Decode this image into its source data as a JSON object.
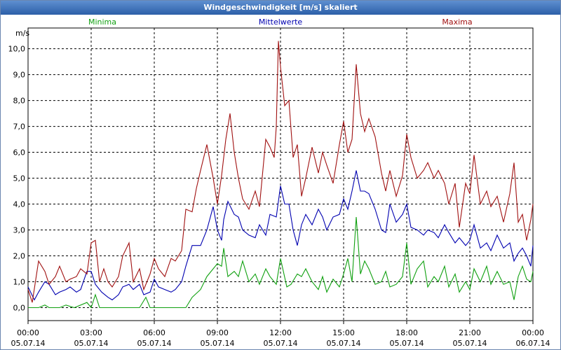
{
  "window": {
    "title": "Windgeschwindigkeit [m/s] skaliert"
  },
  "chart_data": {
    "type": "line",
    "title": "Windgeschwindigkeit [m/s] skaliert",
    "ylabel": "m/s",
    "ylim": [
      -0.5,
      10.8
    ],
    "grid": true,
    "legend_position": "top",
    "y_ticks": [
      "0,0",
      "1,0",
      "2,0",
      "3,0",
      "4,0",
      "5,0",
      "6,0",
      "7,0",
      "8,0",
      "9,0",
      "10,0"
    ],
    "y_tick_values": [
      0,
      1,
      2,
      3,
      4,
      5,
      6,
      7,
      8,
      9,
      10
    ],
    "x_ticks": [
      {
        "time": "00:00",
        "date": "05.07.14"
      },
      {
        "time": "03:00",
        "date": "05.07.14"
      },
      {
        "time": "06:00",
        "date": "05.07.14"
      },
      {
        "time": "09:00",
        "date": "05.07.14"
      },
      {
        "time": "12:00",
        "date": "05.07.14"
      },
      {
        "time": "15:00",
        "date": "05.07.14"
      },
      {
        "time": "18:00",
        "date": "05.07.14"
      },
      {
        "time": "21:00",
        "date": "05.07.14"
      },
      {
        "time": "00:00",
        "date": "06.07.14"
      }
    ],
    "x_tick_hours": [
      0,
      3,
      6,
      9,
      12,
      15,
      18,
      21,
      24
    ],
    "x_range_hours": [
      0,
      24
    ],
    "series": [
      {
        "name": "Minima",
        "color": "#10a010",
        "points": [
          [
            0,
            0
          ],
          [
            0.5,
            0
          ],
          [
            0.8,
            0.1
          ],
          [
            1.0,
            0
          ],
          [
            1.5,
            0
          ],
          [
            1.8,
            0.1
          ],
          [
            2.2,
            0
          ],
          [
            2.8,
            0.2
          ],
          [
            3.0,
            0
          ],
          [
            3.2,
            0.5
          ],
          [
            3.4,
            0
          ],
          [
            4.0,
            0
          ],
          [
            4.5,
            0
          ],
          [
            5.0,
            0
          ],
          [
            5.3,
            0
          ],
          [
            5.6,
            0.4
          ],
          [
            5.8,
            0
          ],
          [
            6.2,
            0
          ],
          [
            6.5,
            0
          ],
          [
            7.0,
            0
          ],
          [
            7.5,
            0
          ],
          [
            7.8,
            0.4
          ],
          [
            8.2,
            0.7
          ],
          [
            8.5,
            1.2
          ],
          [
            8.8,
            1.5
          ],
          [
            9.0,
            1.7
          ],
          [
            9.2,
            1.6
          ],
          [
            9.3,
            2.3
          ],
          [
            9.5,
            1.2
          ],
          [
            9.8,
            1.4
          ],
          [
            10.0,
            1.2
          ],
          [
            10.2,
            1.8
          ],
          [
            10.5,
            1.0
          ],
          [
            10.8,
            1.3
          ],
          [
            11.0,
            0.9
          ],
          [
            11.3,
            1.5
          ],
          [
            11.5,
            1.2
          ],
          [
            11.8,
            0.9
          ],
          [
            12.0,
            1.9
          ],
          [
            12.3,
            0.8
          ],
          [
            12.5,
            0.9
          ],
          [
            12.8,
            1.3
          ],
          [
            13.0,
            1.2
          ],
          [
            13.2,
            1.5
          ],
          [
            13.5,
            1.0
          ],
          [
            13.8,
            0.7
          ],
          [
            14.0,
            1.2
          ],
          [
            14.2,
            0.6
          ],
          [
            14.5,
            1.1
          ],
          [
            14.8,
            0.8
          ],
          [
            15.0,
            1.3
          ],
          [
            15.2,
            1.9
          ],
          [
            15.4,
            1.0
          ],
          [
            15.6,
            3.5
          ],
          [
            15.8,
            1.3
          ],
          [
            16.0,
            1.8
          ],
          [
            16.2,
            1.5
          ],
          [
            16.5,
            0.9
          ],
          [
            16.8,
            1.0
          ],
          [
            17.0,
            1.4
          ],
          [
            17.2,
            0.8
          ],
          [
            17.5,
            0.9
          ],
          [
            17.8,
            1.2
          ],
          [
            18.0,
            2.5
          ],
          [
            18.2,
            0.9
          ],
          [
            18.5,
            1.5
          ],
          [
            18.8,
            1.8
          ],
          [
            19.0,
            0.8
          ],
          [
            19.3,
            1.2
          ],
          [
            19.5,
            1.0
          ],
          [
            19.8,
            1.6
          ],
          [
            20.0,
            0.8
          ],
          [
            20.3,
            1.3
          ],
          [
            20.5,
            0.6
          ],
          [
            20.8,
            1.0
          ],
          [
            21.0,
            0.7
          ],
          [
            21.2,
            1.5
          ],
          [
            21.5,
            1.0
          ],
          [
            21.8,
            1.6
          ],
          [
            22.0,
            0.9
          ],
          [
            22.3,
            1.4
          ],
          [
            22.6,
            0.9
          ],
          [
            22.9,
            1.0
          ],
          [
            23.1,
            0.3
          ],
          [
            23.3,
            1.2
          ],
          [
            23.5,
            1.6
          ],
          [
            23.7,
            1.1
          ],
          [
            23.9,
            1.0
          ],
          [
            24.0,
            1.4
          ]
        ]
      },
      {
        "name": "Mittelwerte",
        "color": "#0000b0",
        "points": [
          [
            0,
            0.8
          ],
          [
            0.3,
            0.3
          ],
          [
            0.5,
            0.6
          ],
          [
            0.8,
            1.0
          ],
          [
            1.0,
            0.9
          ],
          [
            1.3,
            0.5
          ],
          [
            1.5,
            0.6
          ],
          [
            1.8,
            0.7
          ],
          [
            2.0,
            0.8
          ],
          [
            2.3,
            0.6
          ],
          [
            2.5,
            0.7
          ],
          [
            2.8,
            1.4
          ],
          [
            3.0,
            1.4
          ],
          [
            3.2,
            0.9
          ],
          [
            3.5,
            0.6
          ],
          [
            3.8,
            0.4
          ],
          [
            4.0,
            0.3
          ],
          [
            4.3,
            0.5
          ],
          [
            4.5,
            0.8
          ],
          [
            4.8,
            0.9
          ],
          [
            5.0,
            0.7
          ],
          [
            5.3,
            0.9
          ],
          [
            5.5,
            0.5
          ],
          [
            5.8,
            0.6
          ],
          [
            6.0,
            1.1
          ],
          [
            6.2,
            0.8
          ],
          [
            6.5,
            0.7
          ],
          [
            6.8,
            0.6
          ],
          [
            7.0,
            0.7
          ],
          [
            7.3,
            1.0
          ],
          [
            7.5,
            1.6
          ],
          [
            7.8,
            2.4
          ],
          [
            8.2,
            2.4
          ],
          [
            8.5,
            3.0
          ],
          [
            8.8,
            3.9
          ],
          [
            9.0,
            3.0
          ],
          [
            9.2,
            2.6
          ],
          [
            9.3,
            3.4
          ],
          [
            9.5,
            4.1
          ],
          [
            9.8,
            3.6
          ],
          [
            10.0,
            3.5
          ],
          [
            10.2,
            3.0
          ],
          [
            10.5,
            2.8
          ],
          [
            10.8,
            2.7
          ],
          [
            11.0,
            3.2
          ],
          [
            11.3,
            2.8
          ],
          [
            11.5,
            3.6
          ],
          [
            11.8,
            3.5
          ],
          [
            12.0,
            4.7
          ],
          [
            12.2,
            4.0
          ],
          [
            12.4,
            4.0
          ],
          [
            12.6,
            3.0
          ],
          [
            12.8,
            2.4
          ],
          [
            13.0,
            3.2
          ],
          [
            13.2,
            3.6
          ],
          [
            13.5,
            3.2
          ],
          [
            13.8,
            3.8
          ],
          [
            14.0,
            3.5
          ],
          [
            14.2,
            3.0
          ],
          [
            14.5,
            3.5
          ],
          [
            14.8,
            3.6
          ],
          [
            15.0,
            4.2
          ],
          [
            15.2,
            3.8
          ],
          [
            15.4,
            4.5
          ],
          [
            15.6,
            5.3
          ],
          [
            15.8,
            4.5
          ],
          [
            16.0,
            4.5
          ],
          [
            16.2,
            4.4
          ],
          [
            16.5,
            3.8
          ],
          [
            16.8,
            3.0
          ],
          [
            17.0,
            2.9
          ],
          [
            17.2,
            4.0
          ],
          [
            17.5,
            3.3
          ],
          [
            17.8,
            3.6
          ],
          [
            18.0,
            4.0
          ],
          [
            18.2,
            3.1
          ],
          [
            18.5,
            3.0
          ],
          [
            18.8,
            2.8
          ],
          [
            19.0,
            3.0
          ],
          [
            19.3,
            2.9
          ],
          [
            19.5,
            2.7
          ],
          [
            19.8,
            3.2
          ],
          [
            20.0,
            2.9
          ],
          [
            20.3,
            2.5
          ],
          [
            20.5,
            2.7
          ],
          [
            20.8,
            2.4
          ],
          [
            21.0,
            2.6
          ],
          [
            21.2,
            3.2
          ],
          [
            21.5,
            2.3
          ],
          [
            21.8,
            2.5
          ],
          [
            22.0,
            2.2
          ],
          [
            22.3,
            2.8
          ],
          [
            22.6,
            2.3
          ],
          [
            22.9,
            2.5
          ],
          [
            23.1,
            1.8
          ],
          [
            23.3,
            2.1
          ],
          [
            23.5,
            2.3
          ],
          [
            23.7,
            2.0
          ],
          [
            23.9,
            1.6
          ],
          [
            24.0,
            2.4
          ]
        ]
      },
      {
        "name": "Maxima",
        "color": "#a01010",
        "points": [
          [
            0,
            0.7
          ],
          [
            0.2,
            0.2
          ],
          [
            0.5,
            1.8
          ],
          [
            0.8,
            1.4
          ],
          [
            1.0,
            0.9
          ],
          [
            1.3,
            1.2
          ],
          [
            1.5,
            1.6
          ],
          [
            1.8,
            1.0
          ],
          [
            2.0,
            1.1
          ],
          [
            2.3,
            1.2
          ],
          [
            2.5,
            1.5
          ],
          [
            2.8,
            1.3
          ],
          [
            3.0,
            2.5
          ],
          [
            3.2,
            2.6
          ],
          [
            3.4,
            1.0
          ],
          [
            3.6,
            1.5
          ],
          [
            3.8,
            1.0
          ],
          [
            4.0,
            0.8
          ],
          [
            4.3,
            1.2
          ],
          [
            4.5,
            2.0
          ],
          [
            4.8,
            2.5
          ],
          [
            5.0,
            1.0
          ],
          [
            5.3,
            1.5
          ],
          [
            5.5,
            0.7
          ],
          [
            5.8,
            1.3
          ],
          [
            6.0,
            1.9
          ],
          [
            6.2,
            1.5
          ],
          [
            6.5,
            1.2
          ],
          [
            6.8,
            1.9
          ],
          [
            7.0,
            1.8
          ],
          [
            7.3,
            2.2
          ],
          [
            7.5,
            3.8
          ],
          [
            7.8,
            3.7
          ],
          [
            8.0,
            4.6
          ],
          [
            8.2,
            5.3
          ],
          [
            8.5,
            6.3
          ],
          [
            8.8,
            5.0
          ],
          [
            9.0,
            4.0
          ],
          [
            9.2,
            5.1
          ],
          [
            9.4,
            6.5
          ],
          [
            9.6,
            7.5
          ],
          [
            9.8,
            6.0
          ],
          [
            10.0,
            5.0
          ],
          [
            10.2,
            4.2
          ],
          [
            10.5,
            3.8
          ],
          [
            10.8,
            4.5
          ],
          [
            11.0,
            3.9
          ],
          [
            11.3,
            6.5
          ],
          [
            11.5,
            6.2
          ],
          [
            11.7,
            5.8
          ],
          [
            11.8,
            7.0
          ],
          [
            11.9,
            10.3
          ],
          [
            12.0,
            9.3
          ],
          [
            12.2,
            7.8
          ],
          [
            12.4,
            8.0
          ],
          [
            12.6,
            5.8
          ],
          [
            12.8,
            6.3
          ],
          [
            13.0,
            4.3
          ],
          [
            13.2,
            5.0
          ],
          [
            13.5,
            6.2
          ],
          [
            13.8,
            5.2
          ],
          [
            14.0,
            6.0
          ],
          [
            14.2,
            5.5
          ],
          [
            14.5,
            4.8
          ],
          [
            14.8,
            6.3
          ],
          [
            15.0,
            7.2
          ],
          [
            15.2,
            6.0
          ],
          [
            15.4,
            6.5
          ],
          [
            15.6,
            9.4
          ],
          [
            15.8,
            7.5
          ],
          [
            16.0,
            6.8
          ],
          [
            16.2,
            7.3
          ],
          [
            16.5,
            6.6
          ],
          [
            16.8,
            5.2
          ],
          [
            17.0,
            4.5
          ],
          [
            17.2,
            5.3
          ],
          [
            17.5,
            4.3
          ],
          [
            17.8,
            5.1
          ],
          [
            18.0,
            6.7
          ],
          [
            18.2,
            5.8
          ],
          [
            18.5,
            5.0
          ],
          [
            18.8,
            5.3
          ],
          [
            19.0,
            5.6
          ],
          [
            19.3,
            5.0
          ],
          [
            19.5,
            5.3
          ],
          [
            19.8,
            4.8
          ],
          [
            20.0,
            4.0
          ],
          [
            20.3,
            4.8
          ],
          [
            20.5,
            3.1
          ],
          [
            20.8,
            4.8
          ],
          [
            21.0,
            4.4
          ],
          [
            21.2,
            5.9
          ],
          [
            21.5,
            4.0
          ],
          [
            21.8,
            4.5
          ],
          [
            22.0,
            3.9
          ],
          [
            22.3,
            4.3
          ],
          [
            22.6,
            3.3
          ],
          [
            22.9,
            4.4
          ],
          [
            23.1,
            5.6
          ],
          [
            23.3,
            3.3
          ],
          [
            23.5,
            3.6
          ],
          [
            23.7,
            2.6
          ],
          [
            23.9,
            3.4
          ],
          [
            24.0,
            4.0
          ]
        ]
      }
    ]
  }
}
